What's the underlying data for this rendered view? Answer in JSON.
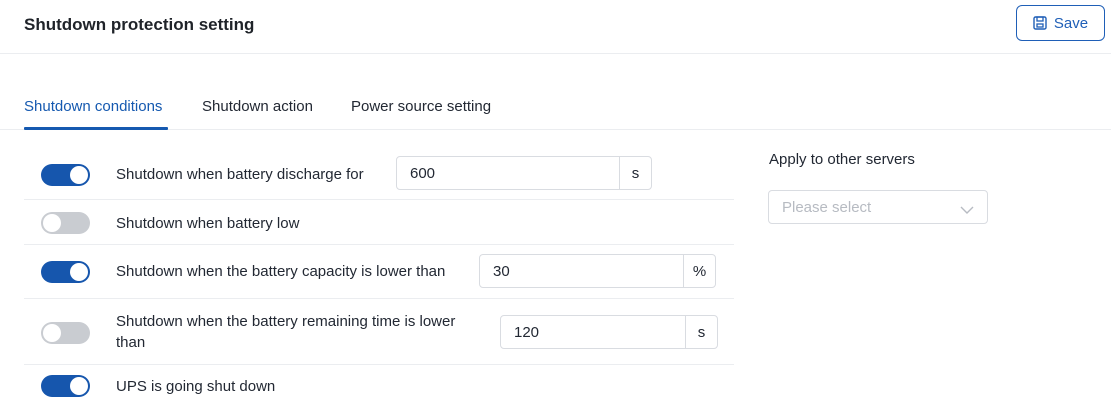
{
  "header": {
    "title": "Shutdown protection setting",
    "save_label": "Save"
  },
  "tabs": [
    {
      "label": "Shutdown conditions",
      "active": true
    },
    {
      "label": "Shutdown action",
      "active": false
    },
    {
      "label": "Power source setting",
      "active": false
    }
  ],
  "conditions": [
    {
      "label": "Shutdown when battery discharge for",
      "enabled": true,
      "value": "600",
      "unit": "s"
    },
    {
      "label": "Shutdown when battery low",
      "enabled": false
    },
    {
      "label": "Shutdown when the battery capacity is lower than",
      "enabled": true,
      "value": "30",
      "unit": "%"
    },
    {
      "label_line1": "Shutdown when the battery remaining time is lower",
      "label_line2": "than",
      "enabled": false,
      "value": "120",
      "unit": "s"
    },
    {
      "label": "UPS is going shut down",
      "enabled": true
    }
  ],
  "apply": {
    "label": "Apply to other servers",
    "placeholder": "Please select"
  },
  "colors": {
    "accent": "#1559b0",
    "toggle_off": "#c9ccd1",
    "border": "#d9dce1"
  },
  "icons": {
    "save": "save-icon",
    "dropdown": "chevron-down-icon"
  }
}
